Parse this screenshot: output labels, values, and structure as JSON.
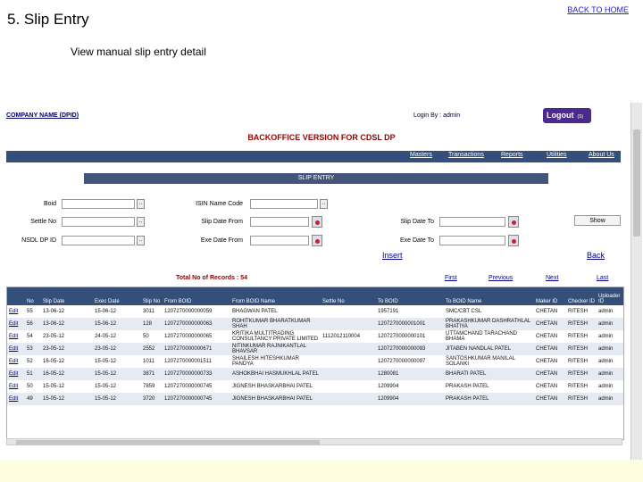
{
  "slide": {
    "title": "5. Slip Entry",
    "back_home": "BACK TO HOME",
    "subtitle": "View manual slip entry detail"
  },
  "app": {
    "company": "COMPANY NAME (DPID)",
    "login_by": "Login By : admin",
    "logout": "Logout",
    "backoffice_title": "BACKOFFICE VERSION FOR CDSL DP",
    "nav": [
      "Masters",
      "Transactions",
      "Reports",
      "Utilities",
      "About Us"
    ],
    "section_title": "SLIP ENTRY"
  },
  "form": {
    "boid_label": "Boid",
    "isin_label": "ISIN Name Code",
    "settle_label": "Settle No",
    "slipdate_from_label": "Slip Date From",
    "slipdate_to_label": "Slip Date To",
    "nsdl_label": "NSDL DP ID",
    "execdate_from_label": "Exe Date From",
    "execdate_to_label": "Exe Date To",
    "show_button": "Show"
  },
  "actions": {
    "insert": "Insert",
    "back": "Back",
    "total_records": "Total No of Records : 54",
    "first": "First",
    "previous": "Previous",
    "next": "Next",
    "last": "Last"
  },
  "table": {
    "columns": [
      "",
      "No",
      "Slip Date",
      "Exec Date",
      "Slip No",
      "From BOID",
      "From BOID Name",
      "Settle No",
      "To BOID",
      "To BOID Name",
      "Maker ID",
      "Checker ID",
      "Uploader ID"
    ],
    "rows": [
      [
        "Edit",
        "55",
        "13-06-12",
        "15-06-12",
        "3011",
        "1207270000000059",
        "BHAGWAN PATEL",
        "",
        "1957191",
        "SMC/CBT CSL",
        "CHETAN",
        "RITESH",
        "admin"
      ],
      [
        "Edit",
        "56",
        "13-06-12",
        "15-06-12",
        "128",
        "1207270000000063",
        "ROHITKUMAR BHARATKUMAR SHAH",
        "",
        "1207270000001001",
        "PRAKASHKUMAR DASHRATHLAL BHATIYA",
        "CHETAN",
        "RITESH",
        "admin"
      ],
      [
        "Edit",
        "54",
        "23-05-12",
        "24-05-12",
        "50",
        "1207270000000065",
        "KRITIKA MULTITRADING CONSULTANCY PRIVATE LIMITED",
        "1112012110004",
        "1207270000000101",
        "UTTAMCHAND TARACHAND BHAMA",
        "CHETAN",
        "RITESH",
        "admin"
      ],
      [
        "Edit",
        "53",
        "23-05-12",
        "23-05-12",
        "2552",
        "1207270000000671",
        "NITINKUMAR RAJNIKANTLAL BHAVSAR",
        "",
        "1207270000000093",
        "JITABEN NANDLAL PATEL",
        "CHETAN",
        "RITESH",
        "admin"
      ],
      [
        "Edit",
        "52",
        "16-05-12",
        "15-05-12",
        "1011",
        "1207270000001511",
        "SHAILESH HITESHKUMAR PANDYA",
        "",
        "1207270000000097",
        "SANTOSHKUMAR MANILAL SOLANKI",
        "CHETAN",
        "RITESH",
        "admin"
      ],
      [
        "Edit",
        "51",
        "16-05-12",
        "15-05-12",
        "3871",
        "1207270000000733",
        "ASHOKBHAI HASMUKHLAL PATEL",
        "",
        "1280081",
        "BHARATI PATEL",
        "CHETAN",
        "RITESH",
        "admin"
      ],
      [
        "Edit",
        "50",
        "15-05-12",
        "15-05-12",
        "7859",
        "1207270000000745",
        "JIGNESH BHASKARBHAI PATEL",
        "",
        "1209904",
        "PRAKASH PATEL",
        "CHETAN",
        "RITESH",
        "admin"
      ],
      [
        "Edit",
        "49",
        "15-05-12",
        "15-05-12",
        "3720",
        "1207270000000745",
        "JIGNESH BHASKARBHAI PATEL",
        "",
        "1209904",
        "PRAKASH PATEL",
        "CHETAN",
        "RITESH",
        "admin"
      ]
    ]
  },
  "colors": {
    "navbar": "#344f7a",
    "logout": "#4a2a8a",
    "title_red": "#990000",
    "footer_band": "#fefde0"
  }
}
